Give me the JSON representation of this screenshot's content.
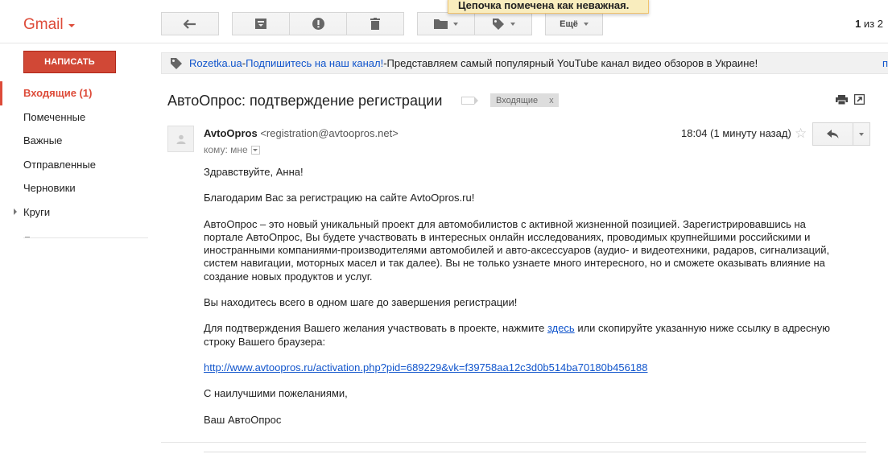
{
  "app": {
    "logo": "Gmail"
  },
  "notification": "Цепочка помечена как неважная.",
  "toolbar": {
    "more_label": "Ещё",
    "counter_current": "1",
    "counter_sep": " из ",
    "counter_total": "2"
  },
  "sidebar": {
    "compose_label": "НАПИСАТЬ",
    "items": [
      {
        "label": "Входящие (1)",
        "active": true
      },
      {
        "label": "Помеченные"
      },
      {
        "label": "Важные"
      },
      {
        "label": "Отправленные"
      },
      {
        "label": "Черновики"
      },
      {
        "label": "Круги",
        "expandable": true
      }
    ]
  },
  "ad": {
    "source": "Rozetka.ua",
    "dash": " - ",
    "title": "Подпишитесь на наш канал!",
    "dash2": " - ",
    "text": "Представляем самый популярный YouTube канал видео обзоров в Украине!",
    "edge": "п"
  },
  "thread": {
    "subject": "АвтоОпрос: подтверждение регистрации",
    "label": "Входящие",
    "label_close": "x"
  },
  "message": {
    "sender_name": "AvtoOpros",
    "sender_addr": "<registration@avtoopros.net>",
    "to_label": "кому: мне",
    "time": "18:04 (1 минуту назад)",
    "greeting": "Здравствуйте, Анна!",
    "thanks": "Благодарим Вас за регистрацию на сайте AvtoOpros.ru!",
    "about": "АвтоОпрос – это новый уникальный проект для автомобилистов с активной жизненной позицией. Зарегистрировавшись на портале АвтоОпрос, Вы будете участвовать в интересных онлайн исследованиях, проводимых крупнейшими российскими и иностранными компаниями-производителями автомобилей и авто-аксессуаров (аудио- и видеотехники, радаров, сигнализаций, систем навигации, моторных масел и так далее). Вы не только узнаете много интересного, но и сможете оказывать влияние на создание новых продуктов и услуг.",
    "step": "Вы находитесь всего в одном шаге до завершения регистрации!",
    "confirm_before": "Для подтверждения Вашего желания участвовать в проекте, нажмите ",
    "confirm_link": "здесь",
    "confirm_after": " или скопируйте указанную ниже ссылку в адресную строку Вашего браузера:",
    "activation_url": "http://www.avtoopros.ru/activation.php?pid=689229&vk=f39758aa12c3d0b514ba70180b456188",
    "regards": "С наилучшими пожеланиями,",
    "signature": "Ваш АвтоОпрос"
  },
  "colors": {
    "brand_red": "#dd4b39",
    "compose_red": "#d14836",
    "link_blue": "#1155cc",
    "notice_yellow": "#f9edbe"
  },
  "icons": [
    "back-arrow-icon",
    "archive-icon",
    "report-spam-icon",
    "delete-icon",
    "folder-icon",
    "label-tag-icon",
    "print-icon",
    "new-window-icon",
    "reply-icon",
    "star-icon",
    "person-icon",
    "tag-icon"
  ]
}
